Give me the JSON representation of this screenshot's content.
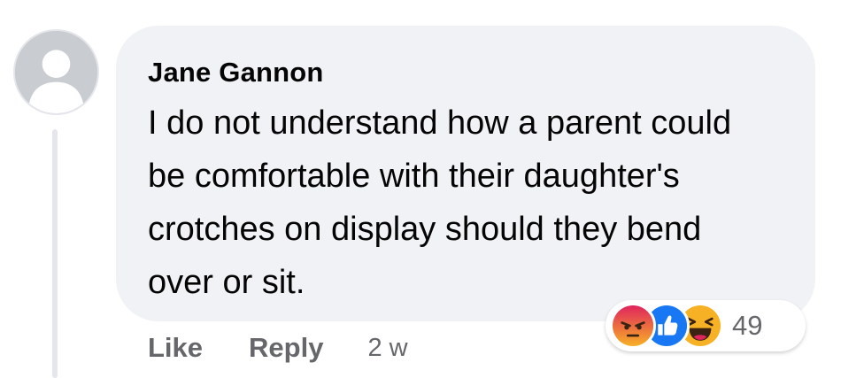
{
  "comment": {
    "author": "Jane Gannon",
    "text": "I do not understand how a parent could be comfortable with their daughter's crotches on display should they bend over or sit.",
    "timestamp": "2 w"
  },
  "actions": {
    "like_label": "Like",
    "reply_label": "Reply"
  },
  "reactions": {
    "count": "49",
    "icons": [
      "angry-icon",
      "like-icon",
      "haha-icon"
    ]
  },
  "colors": {
    "bubble": "#f0f2f5",
    "meta_text": "#65676b",
    "like_blue": "#1877f2",
    "angry_red": "#e9710f",
    "haha_yellow": "#f7b125"
  }
}
